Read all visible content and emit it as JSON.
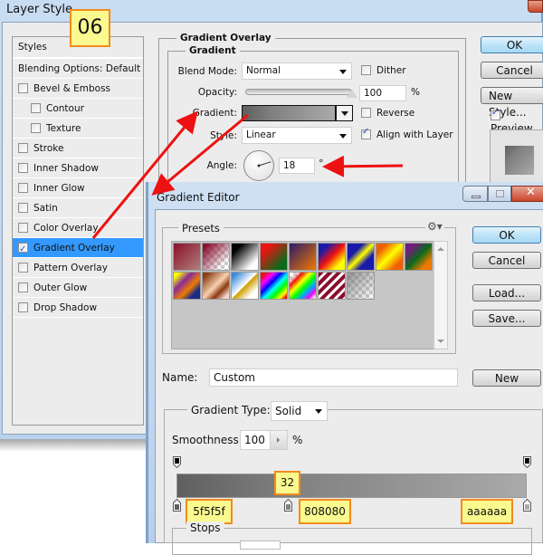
{
  "step_badge": "06",
  "layer_style": {
    "title": "Layer Style",
    "styles_header": "Styles",
    "blending_options": "Blending Options: Default",
    "style_items": [
      {
        "label": "Bevel & Emboss",
        "checked": false,
        "indent": false
      },
      {
        "label": "Contour",
        "checked": false,
        "indent": true
      },
      {
        "label": "Texture",
        "checked": false,
        "indent": true
      },
      {
        "label": "Stroke",
        "checked": false,
        "indent": false
      },
      {
        "label": "Inner Shadow",
        "checked": false,
        "indent": false
      },
      {
        "label": "Inner Glow",
        "checked": false,
        "indent": false
      },
      {
        "label": "Satin",
        "checked": false,
        "indent": false
      },
      {
        "label": "Color Overlay",
        "checked": false,
        "indent": false
      },
      {
        "label": "Gradient Overlay",
        "checked": true,
        "indent": false,
        "selected": true
      },
      {
        "label": "Pattern Overlay",
        "checked": false,
        "indent": false
      },
      {
        "label": "Outer Glow",
        "checked": false,
        "indent": false
      },
      {
        "label": "Drop Shadow",
        "checked": false,
        "indent": false
      }
    ],
    "panel_title": "Gradient Overlay",
    "section_title": "Gradient",
    "blend_mode_label": "Blend Mode:",
    "blend_mode_value": "Normal",
    "dither_label": "Dither",
    "dither_checked": false,
    "opacity_label": "Opacity:",
    "opacity_value": "100",
    "opacity_unit": "%",
    "opacity_fraction": 1.0,
    "gradient_label": "Gradient:",
    "reverse_label": "Reverse",
    "reverse_checked": false,
    "style_label": "Style:",
    "style_value": "Linear",
    "align_label": "Align with Layer",
    "align_checked": true,
    "angle_label": "Angle:",
    "angle_value": "18",
    "angle_unit": "°",
    "buttons": {
      "ok": "OK",
      "cancel": "Cancel",
      "new_style": "New Style..."
    },
    "preview_label": "Preview",
    "preview_checked": true
  },
  "gradient_editor": {
    "title": "Gradient Editor",
    "presets_label": "Presets",
    "buttons": {
      "ok": "OK",
      "cancel": "Cancel",
      "load": "Load...",
      "save": "Save...",
      "new": "New"
    },
    "name_label": "Name:",
    "name_value": "Custom",
    "gradient_type_label": "Gradient Type:",
    "gradient_type_value": "Solid",
    "smoothness_label": "Smoothness:",
    "smoothness_value": "100",
    "smoothness_unit": "%",
    "stops_label": "Stops",
    "midpoint_badge": "32",
    "color_stops": [
      {
        "color": "#5f5f5f",
        "label": "5f5f5f",
        "location": 0
      },
      {
        "color": "#808080",
        "label": "808080",
        "location": 32
      },
      {
        "color": "#aaaaaa",
        "label": "aaaaaa",
        "location": 100
      }
    ]
  },
  "colors": {
    "selection": "#3399ff",
    "badge_fill": "#f9f98f",
    "badge_border": "#f28b1e",
    "arrow": "#ee1111"
  }
}
